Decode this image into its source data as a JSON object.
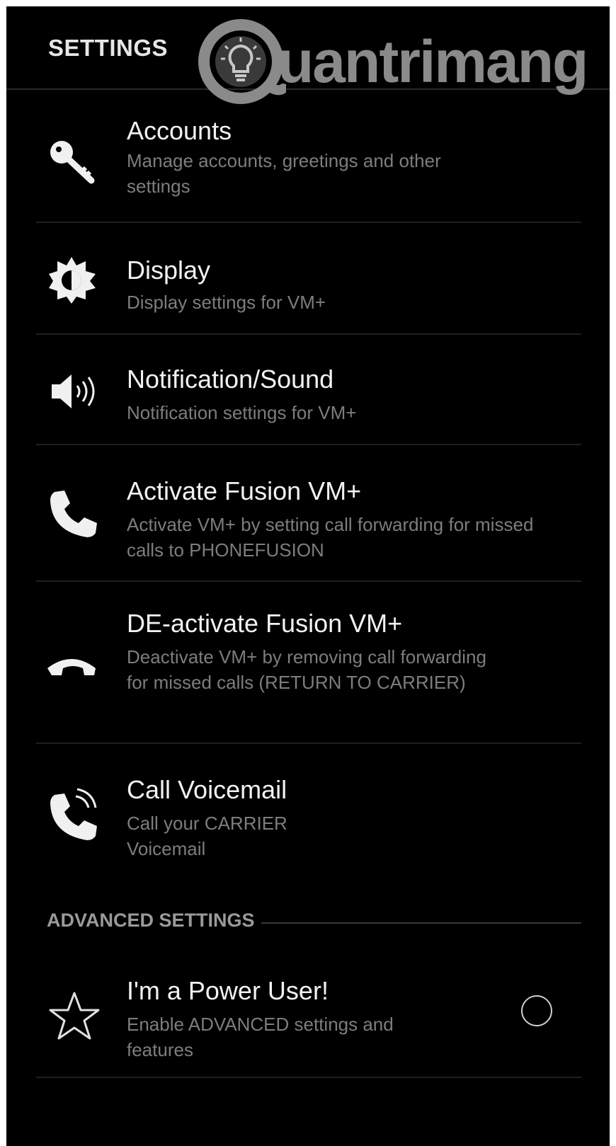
{
  "header": {
    "title": "SETTINGS",
    "watermark_text": "uantrimang"
  },
  "items": [
    {
      "title": "Accounts",
      "summary": "Manage accounts, greetings and other settings",
      "icon": "key-icon"
    },
    {
      "title": "Display",
      "summary": "Display settings for VM+",
      "icon": "brightness-icon"
    },
    {
      "title": "Notification/Sound",
      "summary": "Notification settings for VM+",
      "icon": "speaker-icon"
    },
    {
      "title": "Activate Fusion VM+",
      "summary": "Activate VM+ by setting call forwarding for missed calls to PHONEFUSION",
      "icon": "phone-icon"
    },
    {
      "title": "DE-activate Fusion VM+",
      "summary": "Deactivate VM+ by removing call forwarding for missed calls (RETURN TO CARRIER)",
      "icon": "hang-up-icon"
    },
    {
      "title": "Call Voicemail",
      "summary": "Call your CARRIER Voicemail",
      "icon": "phone-ringing-icon"
    }
  ],
  "advanced": {
    "header": "ADVANCED SETTINGS",
    "power_user": {
      "title": "I'm a Power User!",
      "summary": "Enable ADVANCED settings and features",
      "icon": "star-icon",
      "checked": false
    }
  },
  "colors": {
    "background": "#000000",
    "title": "#f2f2f2",
    "summary": "#7d7d7d",
    "watermark": "#8a8a8a"
  }
}
